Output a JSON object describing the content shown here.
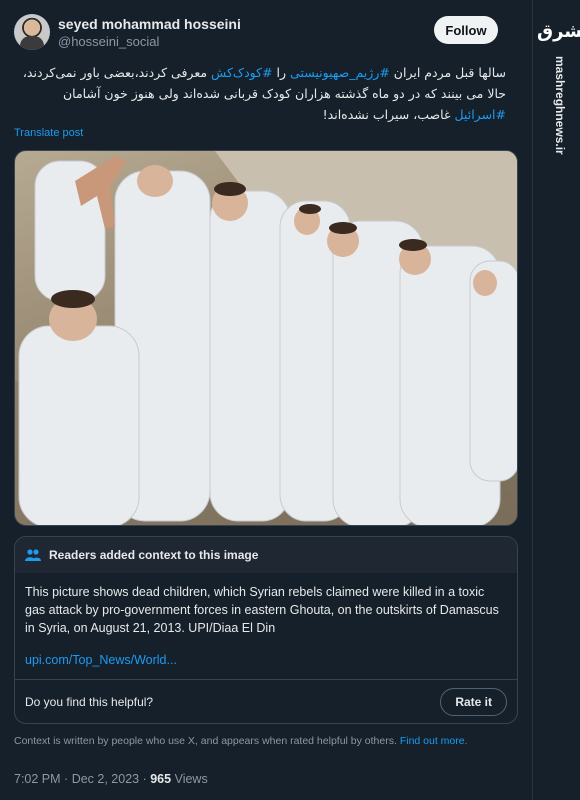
{
  "post": {
    "author_name": "seyed mohammad hosseini",
    "author_handle": "@hosseini_social",
    "follow_label": "Follow",
    "text_segments": [
      {
        "text": "سالها قبل مردم ایران ",
        "tag": false
      },
      {
        "text": "#رژیم_صهیونیستی",
        "tag": true
      },
      {
        "text": " را ",
        "tag": false
      },
      {
        "text": "#کودک‌کش",
        "tag": true
      },
      {
        "text": " معرفی کردند،بعضی باور نمی‌کردند، حالا می بینند که در دو ماه گذشته هزاران کودک قربانی شده‌اند ولی هنوز خون آشامان ",
        "tag": false
      },
      {
        "text": "#اسرائیل",
        "tag": true
      },
      {
        "text": " غاصب، سیراب نشده‌اند!",
        "tag": false
      }
    ],
    "translate_label": "Translate post"
  },
  "community_note": {
    "title": "Readers added context to this image",
    "body": "This picture shows dead children, which Syrian rebels claimed were killed in a toxic gas attack by pro-government forces in eastern Ghouta, on the outskirts of Damascus in Syria, on August 21, 2013. UPI/Diaa El Din",
    "link": "upi.com/Top_News/World...",
    "helpful_question": "Do you find this helpful?",
    "rate_label": "Rate it",
    "disclaimer": "Context is written by people who use X, and appears when rated helpful by others.",
    "find_out_more": "Find out more."
  },
  "meta": {
    "time": "7:02 PM",
    "date": "Dec 2, 2023",
    "views_count": "965",
    "views_label": "Views"
  },
  "watermark": {
    "logo_text": "مشرق",
    "site": "mashreghnews.ir"
  },
  "colors": {
    "background": "#15202b",
    "accent": "#1d9bf0",
    "border": "#38444d"
  }
}
